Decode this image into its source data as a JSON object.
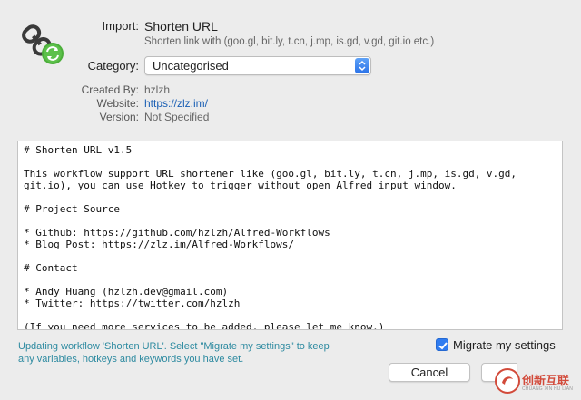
{
  "dialog": {
    "import_label": "Import:",
    "import_title": "Shorten URL",
    "import_description": "Shorten link with (goo.gl, bit.ly, t.cn, j.mp, is.gd, v.gd, git.io etc.)",
    "category_label": "Category:",
    "category_value": "Uncategorised",
    "created_by_label": "Created By:",
    "created_by_value": "hzlzh",
    "website_label": "Website:",
    "website_value": "https://zlz.im/",
    "version_label": "Version:",
    "version_value": "Not Specified"
  },
  "readme": {
    "text": "# Shorten URL v1.5\n\nThis workflow support URL shortener like (goo.gl, bit.ly, t.cn, j.mp, is.gd, v.gd,\ngit.io), you can use Hotkey to trigger without open Alfred input window.\n\n# Project Source\n\n* Github: https://github.com/hzlzh/Alfred-Workflows\n* Blog Post: https://zlz.im/Alfred-Workflows/\n\n# Contact\n\n* Andy Huang (hzlzh.dev@gmail.com)\n* Twitter: https://twitter.com/hzlzh\n\n(If you need more services to be added, please let me know.)"
  },
  "footer": {
    "notice_line1": "Updating workflow 'Shorten URL'. Select \"Migrate my settings\" to keep",
    "notice_line2": "any variables, hotkeys and keywords you have set.",
    "migrate_label": "Migrate my settings",
    "migrate_checked": true,
    "cancel_label": "Cancel"
  },
  "watermark": {
    "text": "创新互联",
    "sub": "CHUANG XIN HU LIAN"
  },
  "colors": {
    "accent": "#2f7cf0",
    "notice": "#2d8aa0",
    "link": "#1a5fb4",
    "watermark": "#d24a3a"
  }
}
